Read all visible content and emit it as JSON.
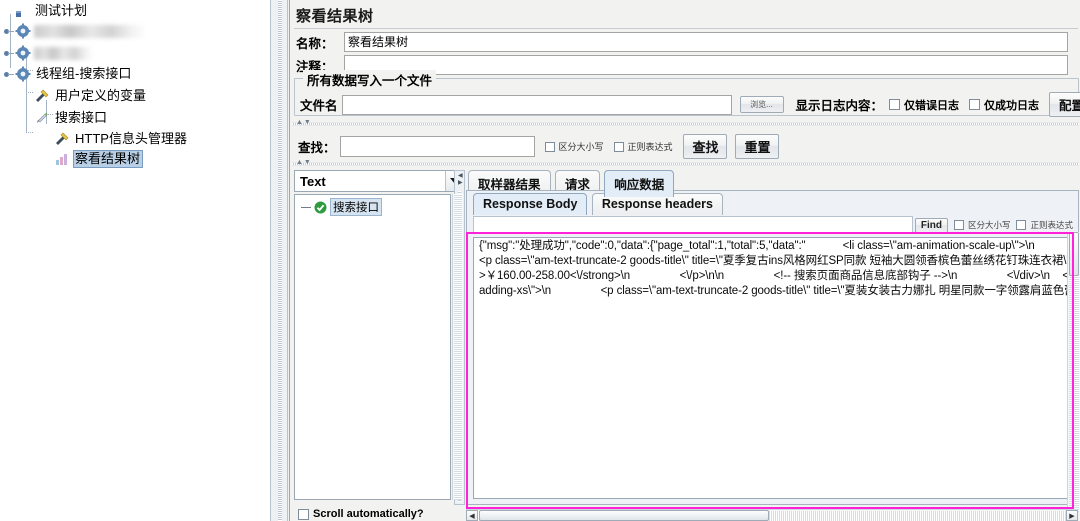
{
  "tree": {
    "items": [
      {
        "label": "测试计划",
        "icon": "test-plan-icon",
        "indent": 16,
        "blurred": false,
        "selected": false
      },
      {
        "label": "",
        "icon": "gear-icon",
        "indent": 4,
        "blurred": true,
        "selected": false,
        "blur_width": 110
      },
      {
        "label": "",
        "icon": "gear-icon",
        "indent": 4,
        "blurred": true,
        "selected": false,
        "blur_width": 60
      },
      {
        "label": "线程组-搜索接口",
        "icon": "gear-icon",
        "indent": 4,
        "blurred": false,
        "selected": false
      },
      {
        "label": "用户定义的变量",
        "icon": "wrench-icon",
        "indent": 20,
        "blurred": false,
        "selected": false
      },
      {
        "label": "搜索接口",
        "icon": "pencil-icon",
        "indent": 20,
        "blurred": false,
        "selected": false
      },
      {
        "label": "HTTP信息头管理器",
        "icon": "wrench-icon",
        "indent": 40,
        "blurred": false,
        "selected": false
      },
      {
        "label": "察看结果树",
        "icon": "chart-icon",
        "indent": 40,
        "blurred": false,
        "selected": true
      }
    ]
  },
  "panel": {
    "title": "察看结果树",
    "name_label": "名称：",
    "name_value": "察看结果树",
    "comment_label": "注释：",
    "comment_value": "",
    "group_title": "所有数据写入一个文件",
    "filename_label": "文件名",
    "filename_value": "",
    "browse_button": "浏览...",
    "log_content_label": "显示日志内容：",
    "only_error_log": "仅错误日志",
    "only_success_log": "仅成功日志",
    "config_button": "配置",
    "search_label": "查找：",
    "search_value": "",
    "case_sensitive": "区分大小写",
    "regex": "正则表达式",
    "search_button": "查找",
    "reset_button": "重置"
  },
  "viewer": {
    "render_combo_value": "Text",
    "result_tree_item": "搜索接口",
    "tabs": [
      {
        "label": "取样器结果",
        "active": false
      },
      {
        "label": "请求",
        "active": false
      },
      {
        "label": "响应数据",
        "active": true
      }
    ],
    "subtabs": [
      {
        "label": "Response Body",
        "active": true
      },
      {
        "label": "Response headers",
        "active": false
      }
    ],
    "find_placeholder": "",
    "find_value": "",
    "find_button": "Find",
    "find_case_sensitive": "区分大小写",
    "find_regex": "正则表达式",
    "scroll_automatically": "Scroll automatically?"
  },
  "response_body": "{\"msg\":\"处理成功\",\"code\":0,\"data\":{\"page_total\":1,\"total\":5,\"data\":\"            <li class=\\\"am-animation-scale-up\\\">\\n                  <div class=\\\"items am-padding-bottom-xs\\\">\\n                    <a href=\\\"http:\\/\\/shopx.lemonban.com\\/?s=goods\\/index\\/id\\/11.html\\\" target=\\\"_blank\\\" class=\\\"am-block\\\">\\n                      <!-- 搜索页面商品信息顶部钩子 -->\\n                      \\n                      <img src=\\\"http:\\/\\/shopx.lemonban.com\\/static\\/upload\\/images\\/goods\\/2019\\/01\\/14\\/1547455566118614.jpg\\\" alt=\\\"夏季复古ins风格网红SP同款 短袖大圆领香槟色蕾丝绣花钉珠连衣裙\\\" class=\\\"goods-images\\\" \\/>\\n                      <div class=\\\"am-padding-xs\\\">\\n                        <p class=\\\"am-text-truncate-2 goods-title\\\" title=\\\"夏季复古ins风格网红SP同款 短袖大圆领香槟色蕾丝绣花钉珠连衣裙\\\">夏季复古ins风格网红SP同款 短袖大圆领香槟色蕾丝绣花钉珠连衣裙<\\/p>\\n                        <\\/div>\\n                        <\\/a>\\n                        <p class=\\\"am-padding-horizontal-xs am-cf\\\">\\n                            <span class=\\\"am-fl original-price\\\">￥268.00-422.00<\\/span>\\n                            <span class=\\\"am-fr sales-count\\\">销量 200001<\\/span>\\n                        <\\/p>\\n\\n                <!-- 搜索页面商品信息售价顶部钩子 -->\\n                \\n                <p class=\\\"price am-padding-horizontal-xs am-text-truncate\\\">\\n                    <strong>￥160.00-258.00<\\/strong>\\n                <\\/p>\\n\\n                <!-- 搜索页面商品信息底部钩子 -->\\n                <\\/div>\\n    <\\/li>\\n      <li class=\\\"am-animation-scale-up\\\">\\n          <div class=\\\"items am-padding-bottom-xs\\\">\\n            <a href=\\\"http:\\/\\/shopx.lemonban.com\\/?s=goods\\/index\\/id\\/10.html\\\" target=\\\"_blank\\\" class=\\\"am-block\\\">\\n              <!-- 搜索页面商品信息顶部钩子 -->\\n              \\n              <img src=\\\"http:\\/\\/shopx.lemonban.com\\/static\\/upload\\/images\\/goods\\/2019\\/01\\/14\\/1547455222990904.jpg\\\" alt=\\\"夏装女装古力娜扎明星同款一字领露肩蓝色蕾丝修身显瘦连衣裙礼服\\\" class=\\\"goods-images\\\" \\/>\\n              <div class=\\\"am-padding-xs\\\">\\n                <p class=\\\"am-text-truncate-2 goods-title\\\" title=\\\"夏装女装古力娜扎 明星同款一字领露肩蓝色蕾丝修身显瘦连衣裙礼服\\\">"
}
